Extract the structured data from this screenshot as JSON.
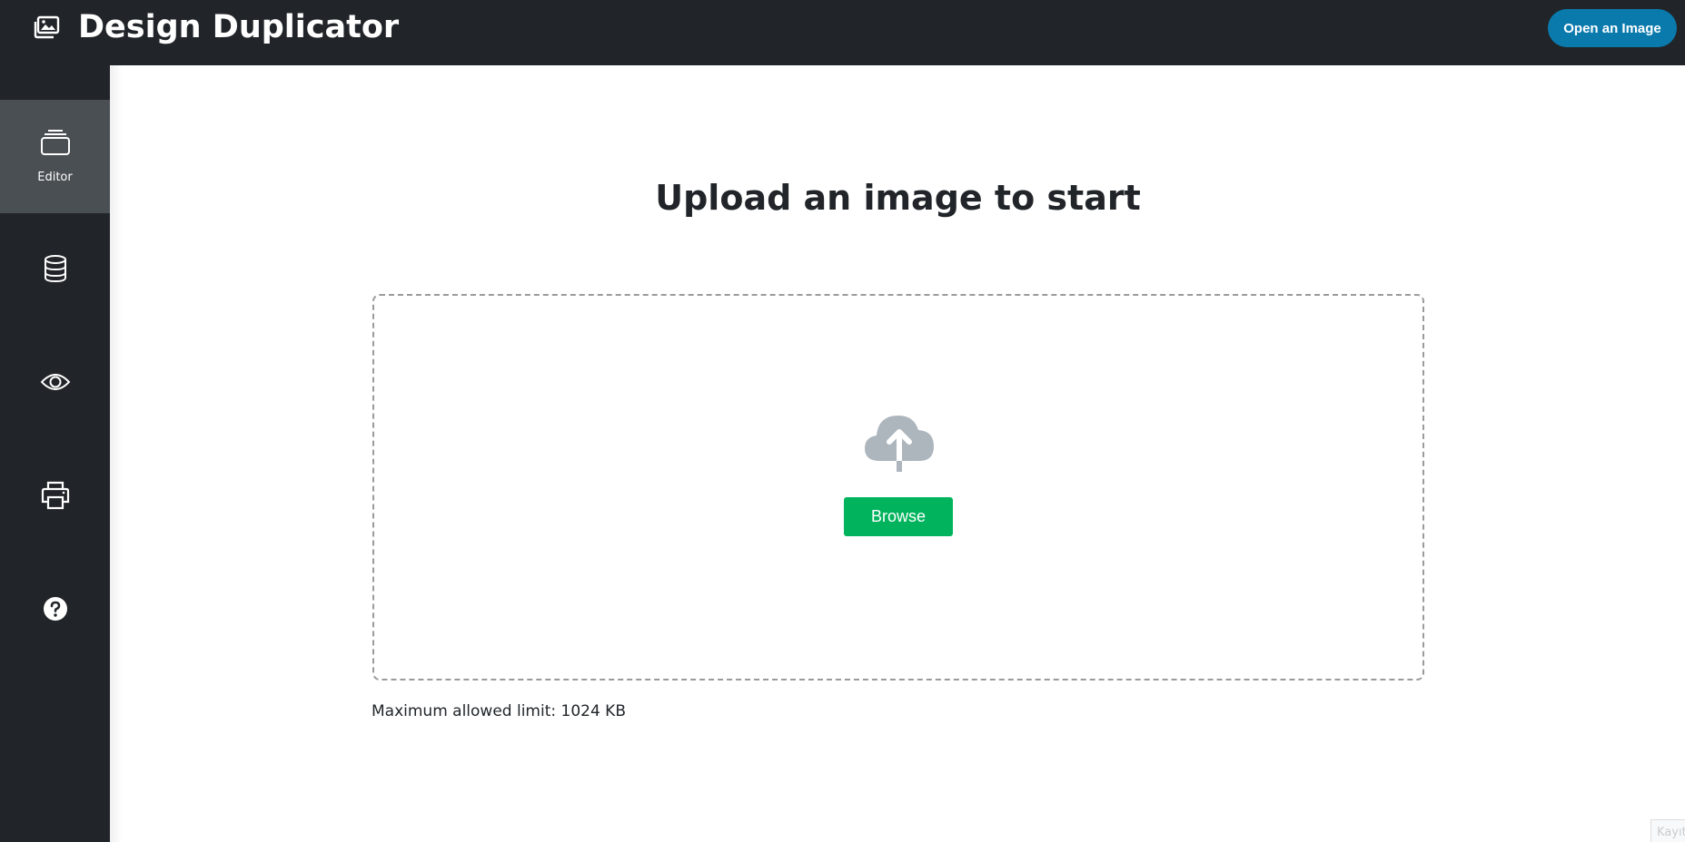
{
  "app": {
    "title": "Design Duplicator",
    "logo_icon": "images-icon",
    "open_button_label": "Open an Image",
    "accent_color": "#0a7aad",
    "topbar_color": "#212529"
  },
  "sidebar": {
    "items": [
      {
        "id": "editor",
        "label": "Editor",
        "icon": "layers-icon",
        "active": true
      },
      {
        "id": "database",
        "label": "",
        "icon": "database-icon",
        "active": false
      },
      {
        "id": "preview",
        "label": "",
        "icon": "eye-icon",
        "active": false
      },
      {
        "id": "print",
        "label": "",
        "icon": "printer-icon",
        "active": false
      },
      {
        "id": "help",
        "label": "",
        "icon": "question-circle-icon",
        "active": false
      }
    ]
  },
  "main": {
    "heading": "Upload an image to start",
    "upload_icon": "cloud-upload-icon",
    "browse_label": "Browse",
    "browse_color": "#00b35c",
    "limit_text": "Maximum allowed limit: 1024 KB"
  },
  "corner": {
    "text": "Kayıt"
  }
}
